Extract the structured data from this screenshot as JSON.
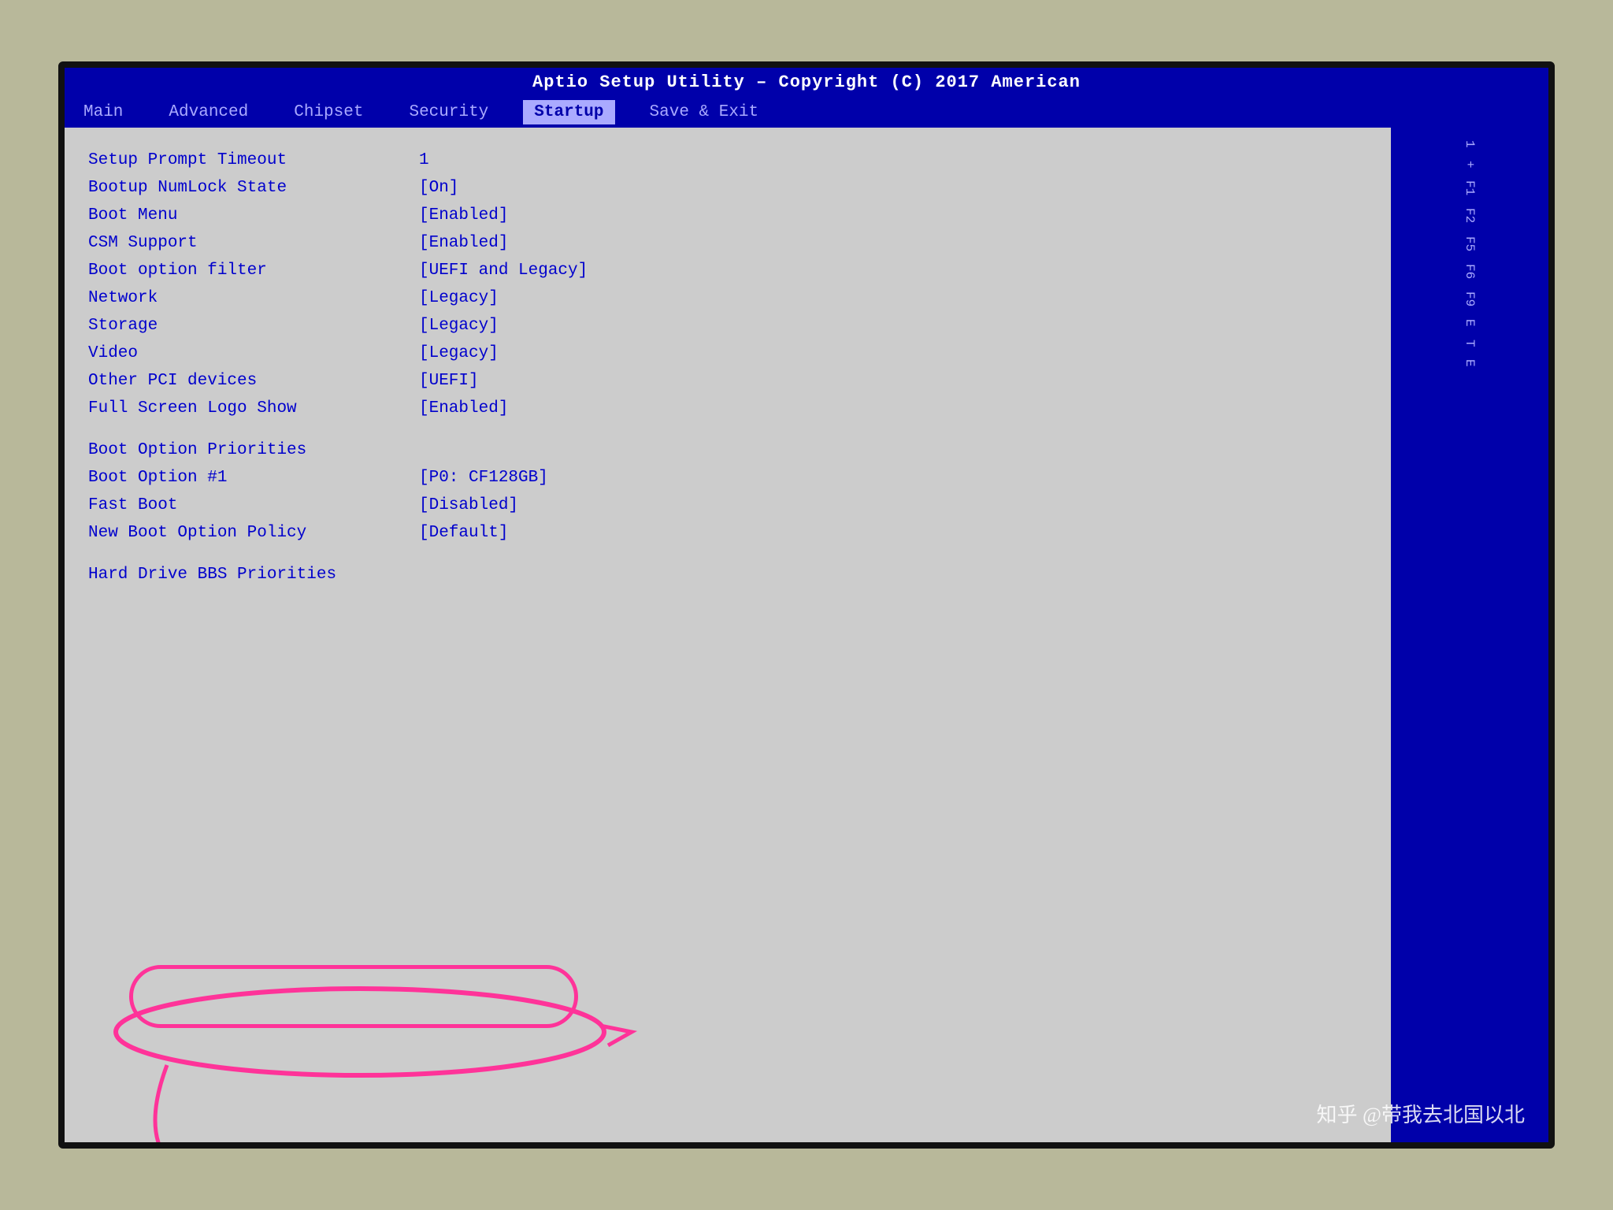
{
  "title_bar": {
    "text": "Aptio Setup Utility – Copyright (C) 2017 American"
  },
  "menu": {
    "items": [
      {
        "label": "Main",
        "active": false
      },
      {
        "label": "Advanced",
        "active": false
      },
      {
        "label": "Chipset",
        "active": false
      },
      {
        "label": "Security",
        "active": false
      },
      {
        "label": "Startup",
        "active": true
      },
      {
        "label": "Save & Exit",
        "active": false
      }
    ]
  },
  "settings": [
    {
      "label": "Setup Prompt Timeout",
      "value": "1"
    },
    {
      "label": "Bootup NumLock State",
      "value": "[On]"
    },
    {
      "label": "Boot Menu",
      "value": "[Enabled]"
    },
    {
      "label": "CSM Support",
      "value": "[Enabled]"
    },
    {
      "label": "Boot option filter",
      "value": "[UEFI and Legacy]"
    },
    {
      "label": "Network",
      "value": "[Legacy]"
    },
    {
      "label": "Storage",
      "value": "[Legacy]"
    },
    {
      "label": "Video",
      "value": "[Legacy]"
    },
    {
      "label": "Other PCI devices",
      "value": "[UEFI]"
    },
    {
      "label": "Full Screen Logo Show",
      "value": "[Enabled]"
    }
  ],
  "settings2": [
    {
      "label": "Boot Option Priorities",
      "value": ""
    },
    {
      "label": "Boot Option #1",
      "value": "[P0: CF128GB]"
    },
    {
      "label": "Fast Boot",
      "value": "[Disabled]"
    },
    {
      "label": "New Boot Option Policy",
      "value": "[Default]"
    }
  ],
  "settings3": [
    {
      "label": "Hard Drive BBS Priorities",
      "value": ""
    }
  ],
  "right_panel": {
    "items": [
      "1",
      "+",
      "F1",
      "F2",
      "F5",
      "F6",
      "F9",
      "E",
      "T",
      "E"
    ]
  },
  "watermark": "知乎 @带我去北国以北"
}
